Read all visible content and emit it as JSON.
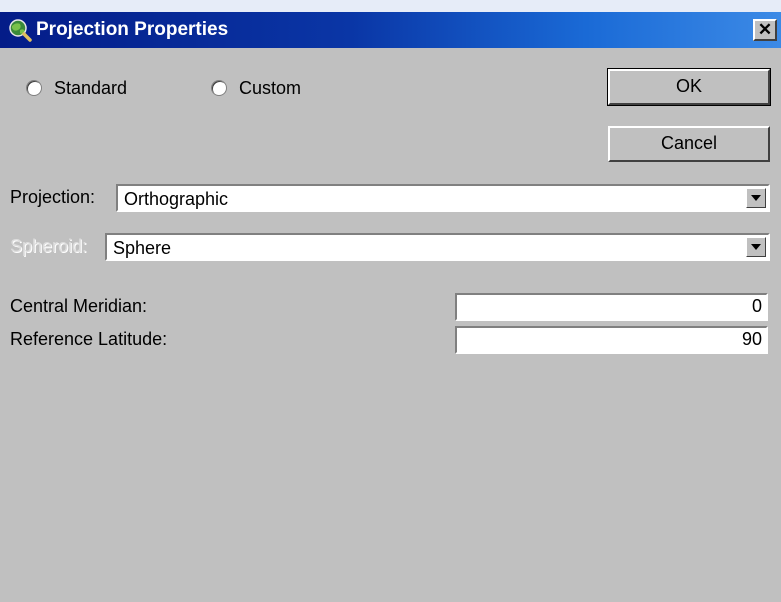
{
  "window": {
    "title": "Projection Properties",
    "close_glyph": "✕"
  },
  "mode": {
    "options": [
      {
        "label": "Standard",
        "selected": false
      },
      {
        "label": "Custom",
        "selected": false
      }
    ]
  },
  "buttons": {
    "ok_label": "OK",
    "cancel_label": "Cancel"
  },
  "projection": {
    "label": "Projection:",
    "value": "Orthographic"
  },
  "spheroid": {
    "label": "Spheroid:",
    "value": "Sphere",
    "enabled": false
  },
  "parameters": [
    {
      "label": "Central Meridian:",
      "value": "0"
    },
    {
      "label": "Reference Latitude:",
      "value": "90"
    }
  ],
  "icons": {
    "title": "globe-magnifier-icon",
    "combo_arrow": "chevron-down-icon"
  },
  "colors": {
    "titlebar_start": "#041c88",
    "titlebar_end": "#3c8ae6",
    "dialog_face": "#c0c0c0",
    "disabled_text": "#dcdcdc"
  }
}
